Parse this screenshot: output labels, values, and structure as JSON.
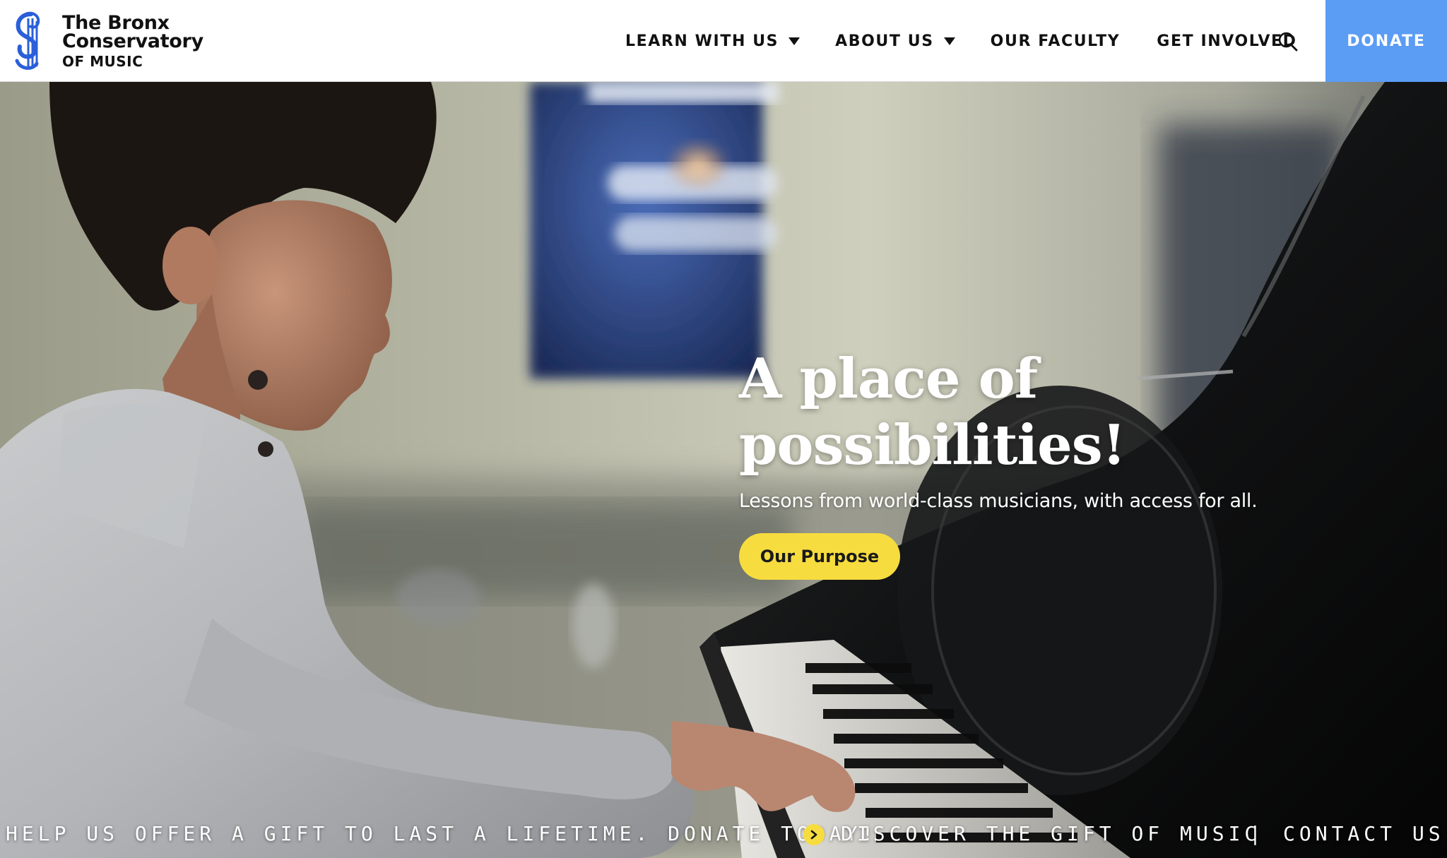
{
  "brand": {
    "line1": "The Bronx",
    "line2": "Conservatory",
    "line3": "OF MUSIC",
    "accent": "#5b9cf5"
  },
  "nav": {
    "items": [
      {
        "label": "LEARN WITH US",
        "has_dropdown": true
      },
      {
        "label": "ABOUT US",
        "has_dropdown": true
      },
      {
        "label": "OUR FACULTY",
        "has_dropdown": false
      },
      {
        "label": "GET INVOLVED",
        "has_dropdown": false
      }
    ],
    "search_icon": "search-icon",
    "donate_label": "DONATE"
  },
  "hero": {
    "title_line1": "A place of",
    "title_line2": "possibilities!",
    "subtitle": "Lessons from world-class musicians, with access for all.",
    "cta_label": "Our Purpose",
    "cta_color": "#f7dc3f"
  },
  "ticker": {
    "message": "HELP US OFFER A GIFT TO LAST A LIFETIME. DONATE TODAY!",
    "arrow_icon": "chevron-right-icon",
    "link1": "DISCOVER THE GIFT OF MUSIC",
    "separator": "|",
    "link2": "CONTACT US"
  }
}
